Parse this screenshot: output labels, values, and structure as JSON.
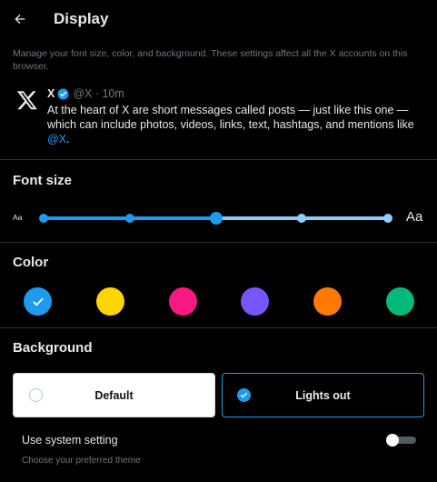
{
  "header": {
    "title": "Display"
  },
  "description": "Manage your font size, color, and background. These settings affect all the X accounts on this browser.",
  "post": {
    "name": "X",
    "meta": "@X · 10m",
    "text": "At the heart of X are short messages called posts — just like this one — which can include photos, videos, links, text, hashtags, and mentions like ",
    "mention": "@X",
    "text_end": "."
  },
  "font_size": {
    "title": "Font size",
    "small_label": "Aa",
    "large_label": "Aa",
    "steps": 5,
    "selected_index": 2
  },
  "color": {
    "title": "Color",
    "options": [
      "#1d9bf0",
      "#ffd400",
      "#f91880",
      "#7856ff",
      "#ff7a00",
      "#00ba7c"
    ],
    "selected_index": 0
  },
  "background": {
    "title": "Background",
    "options": [
      {
        "label": "Default",
        "selected": false
      },
      {
        "label": "Lights out",
        "selected": true
      }
    ],
    "system_label": "Use system setting",
    "system_sub": "Choose your preferred theme",
    "system_enabled": false
  }
}
